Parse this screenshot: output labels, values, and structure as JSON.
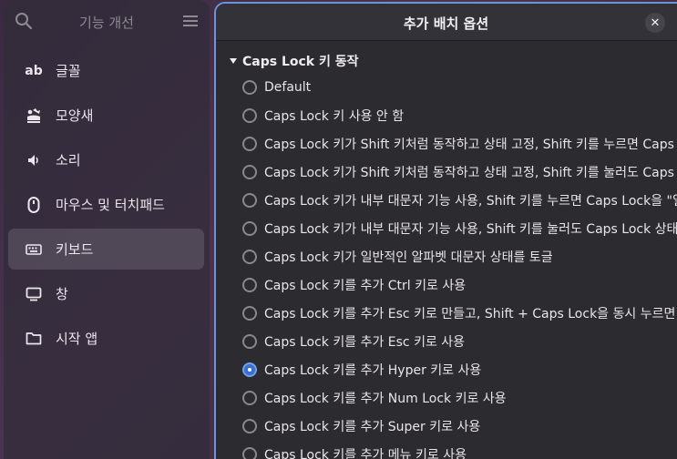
{
  "sidebar": {
    "title": "기능 개선",
    "items": [
      {
        "label": "글꼴",
        "icon": "font-icon",
        "glyph": "ab"
      },
      {
        "label": "모양새",
        "icon": "appearance-icon"
      },
      {
        "label": "소리",
        "icon": "speaker-icon"
      },
      {
        "label": "마우스 및 터치패드",
        "icon": "mouse-icon"
      },
      {
        "label": "키보드",
        "icon": "keyboard-icon",
        "active": true
      },
      {
        "label": "창",
        "icon": "window-icon"
      },
      {
        "label": "시작 앱",
        "icon": "folder-icon"
      }
    ]
  },
  "dialog": {
    "title": "추가 배치 옵션",
    "close_glyph": "✕",
    "section": "Caps Lock 키 동작",
    "options": [
      {
        "label": "Default",
        "selected": false
      },
      {
        "label": "Caps Lock 키 사용 안 함",
        "selected": false
      },
      {
        "label": "Caps Lock 키가 Shift 키처럼 동작하고 상태 고정, Shift 키를 누르면 Caps Lock",
        "selected": false
      },
      {
        "label": "Caps Lock 키가 Shift 키처럼 동작하고 상태 고정, Shift 키를 눌러도 Caps Lock",
        "selected": false
      },
      {
        "label": "Caps Lock 키가 내부 대문자 기능 사용, Shift 키를 누르면 Caps Lock을 \"일시",
        "selected": false
      },
      {
        "label": "Caps Lock 키가 내부 대문자 기능 사용, Shift 키를 눌러도 Caps Lock 상태에",
        "selected": false
      },
      {
        "label": "Caps Lock 키가 일반적인 알파벳 대문자 상태를 토글",
        "selected": false
      },
      {
        "label": "Caps Lock 키를 추가 Ctrl 키로 사용",
        "selected": false
      },
      {
        "label": "Caps Lock 키를 추가 Esc 키로 만들고, Shift + Caps Lock을 동시 누르면 일반",
        "selected": false
      },
      {
        "label": "Caps Lock 키를 추가 Esc 키로 사용",
        "selected": false
      },
      {
        "label": "Caps Lock 키를 추가 Hyper 키로 사용",
        "selected": true
      },
      {
        "label": "Caps Lock 키를 추가 Num Lock 키로 사용",
        "selected": false
      },
      {
        "label": "Caps Lock 키를 추가 Super 키로 사용",
        "selected": false
      },
      {
        "label": "Caps Lock 키를 추가 메뉴 키로 사용",
        "selected": false
      }
    ]
  },
  "colors": {
    "accent": "#3b6fcf",
    "dialog_border": "#6f93d4",
    "dialog_bg": "#2c2b30"
  }
}
